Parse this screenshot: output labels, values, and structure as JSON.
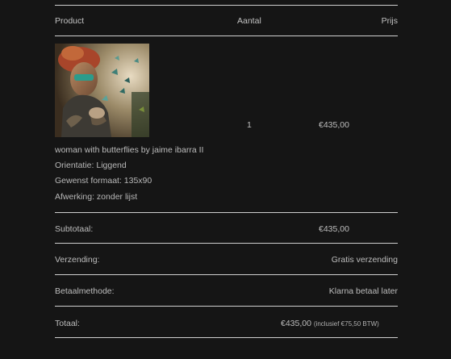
{
  "table": {
    "headers": {
      "product": "Product",
      "quantity": "Aantal",
      "price": "Prijs"
    },
    "item": {
      "image_alt": "woman with butterflies by jaime ibarra II",
      "quantity": "1",
      "price": "€435,00",
      "title": "woman with butterflies by jaime ibarra II",
      "orientation": "Orientatie: Liggend",
      "format": "Gewenst formaat: 135x90",
      "finish": "Afwerking: zonder lijst"
    }
  },
  "summary": {
    "subtotal_label": "Subtotaal:",
    "subtotal_value": "€435,00",
    "shipping_label": "Verzending:",
    "shipping_value": "Gratis verzending",
    "payment_label": "Betaalmethode:",
    "payment_value": "Klarna betaal later",
    "total_label": "Totaal:",
    "total_value": "€435,00",
    "total_tax_note": "(inclusief €75,50 BTW)"
  },
  "colors": {
    "background": "#151515",
    "text": "#bdbdbd",
    "rule": "#cfcfcf"
  }
}
